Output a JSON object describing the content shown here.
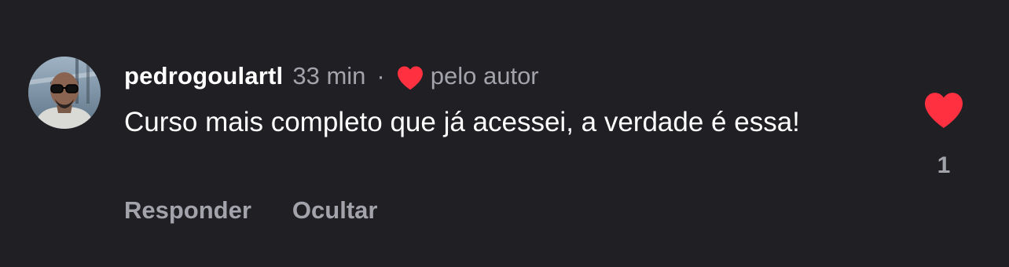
{
  "comment": {
    "author": "pedrogoulartl",
    "time": "33 min",
    "separator": "·",
    "author_liked_label": "pelo autor",
    "author_liked_icon": "heart-icon",
    "text": "Curso mais completo que já acessei, a verdade é essa!",
    "like_count": "1",
    "like_icon": "heart-icon",
    "liked": true,
    "actions": {
      "reply": "Responder",
      "hide": "Ocultar"
    }
  },
  "colors": {
    "background": "#1f1f24",
    "heart": "#ff3040",
    "text": "#ffffff",
    "muted": "#a3a3ab"
  }
}
